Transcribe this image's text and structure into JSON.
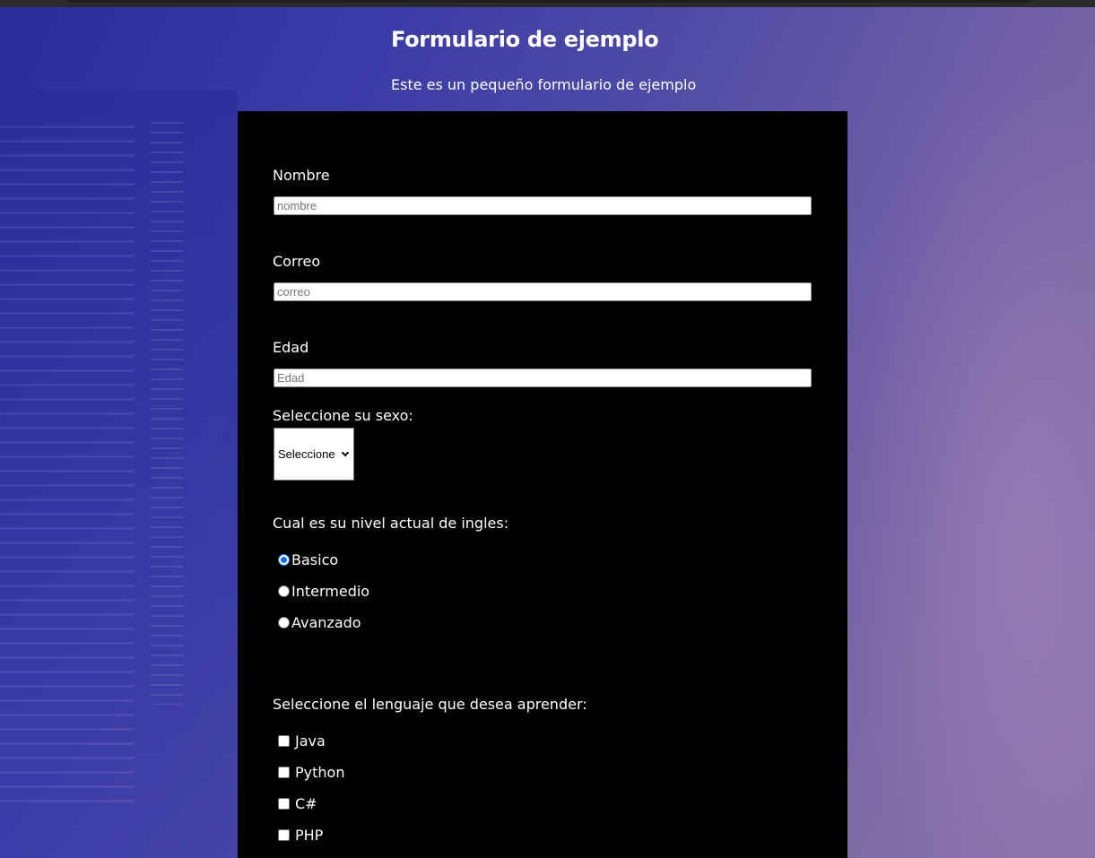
{
  "page": {
    "title": "Formulario de ejemplo",
    "subtitle": "Este es un pequeño formulario de ejemplo"
  },
  "form": {
    "name": {
      "label": "Nombre",
      "placeholder": "nombre",
      "value": ""
    },
    "email": {
      "label": "Correo",
      "placeholder": "correo",
      "value": ""
    },
    "age": {
      "label": "Edad",
      "placeholder": "Edad",
      "value": ""
    },
    "sex": {
      "label": "Seleccione su sexo:",
      "selected": "Seleccione"
    },
    "english_level": {
      "label": "Cual es su nivel actual de ingles:",
      "options": [
        "Basico",
        "Intermedio",
        "Avanzado"
      ],
      "selected": "Basico"
    },
    "languages": {
      "label": "Seleccione el lenguaje que desea aprender:",
      "options": [
        "Java",
        "Python",
        "C#",
        "PHP"
      ],
      "checked": []
    }
  },
  "colors": {
    "panel": "#000000",
    "radio_accent": "#0b6ff5",
    "background_start": "#2a2c9c",
    "background_end": "#8a72a8"
  }
}
